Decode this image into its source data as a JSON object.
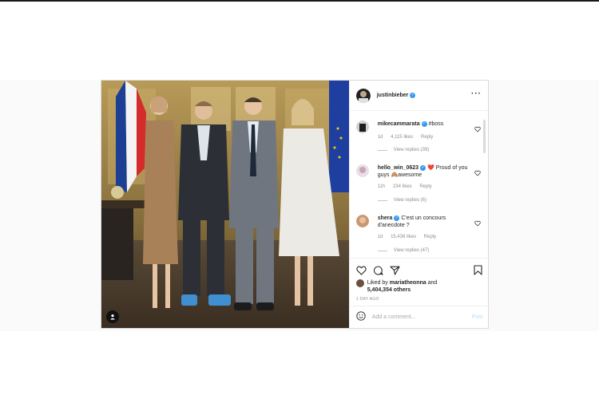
{
  "post": {
    "username": "justinbieber",
    "photo_alt": "Group photo in an ornate room"
  },
  "comments": [
    {
      "username": "mikecammarata",
      "text": "#boss",
      "time": "1d",
      "likes": "4,115 likes",
      "reply_label": "Reply",
      "view_replies": "View replies (39)"
    },
    {
      "username": "hello_win_0623",
      "text": "❤️ Proud of you guys 🙈awesome",
      "time": "11h",
      "likes": "234 likes",
      "reply_label": "Reply",
      "view_replies": "View replies (6)"
    },
    {
      "username": "shera",
      "text": "C'est un concours d'anecdote ?",
      "time": "1d",
      "likes": "15,436 likes",
      "reply_label": "Reply",
      "view_replies": "View replies (47)"
    }
  ],
  "likes": {
    "prefix": "Liked by ",
    "user": "mariatheonna",
    "middle": " and ",
    "count": "5,404,354 others"
  },
  "time_ago": "1 DAY AGO",
  "add_comment": {
    "placeholder": "Add a comment...",
    "post_label": "Post"
  },
  "colors": {
    "verified": "#3897f0",
    "border": "#dbdbdb",
    "muted": "#8e8e8e",
    "heart_red": "#ed4956"
  }
}
